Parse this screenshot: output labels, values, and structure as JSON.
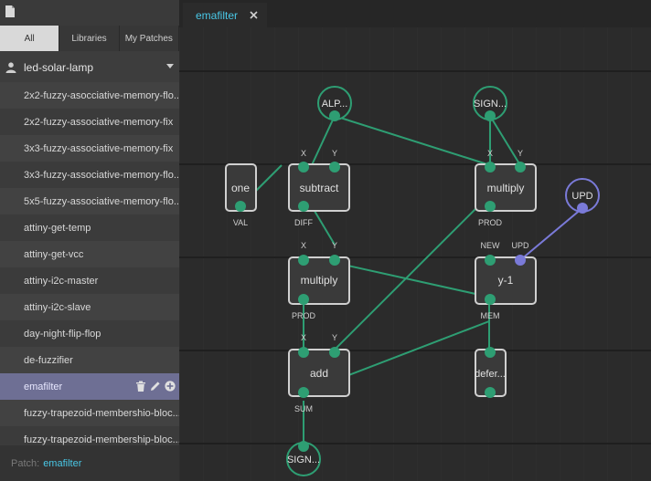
{
  "sidebar": {
    "tabs": [
      {
        "label": "All",
        "active": true
      },
      {
        "label": "Libraries",
        "active": false
      },
      {
        "label": "My Patches",
        "active": false
      }
    ],
    "project": "led-solar-lamp",
    "patches": [
      "2x2-fuzzy-asocciative-memory-flo...",
      "2x2-fuzzy-associative-memory-fix",
      "3x3-fuzzy-associative-memory-fix",
      "3x3-fuzzy-associative-memory-flo...",
      "5x5-fuzzy-associative-memory-flo...",
      "attiny-get-temp",
      "attiny-get-vcc",
      "attiny-i2c-master",
      "attiny-i2c-slave",
      "day-night-flip-flop",
      "de-fuzzifier",
      "emafilter",
      "fuzzy-trapezoid-membershio-bloc...",
      "fuzzy-trapezoid-membership-bloc..."
    ],
    "selected_patch": "emafilter",
    "footer_label": "Patch:",
    "footer_value": "emafilter"
  },
  "editor": {
    "tab_label": "emafilter"
  },
  "graph": {
    "nodes": {
      "alpha": {
        "label": "ALP..."
      },
      "signal_in": {
        "label": "SIGN..."
      },
      "one": {
        "label": "one",
        "out": "VAL"
      },
      "subtract": {
        "label": "subtract",
        "in1": "X",
        "in2": "Y",
        "out": "DIFF"
      },
      "multiply1": {
        "label": "multiply",
        "in1": "X",
        "in2": "Y",
        "out": "PROD"
      },
      "upd": {
        "label": "UPD"
      },
      "multiply2": {
        "label": "multiply",
        "in1": "X",
        "in2": "Y",
        "out": "PROD"
      },
      "buffer": {
        "label": "y-1",
        "in1": "NEW",
        "in2": "UPD",
        "out": "MEM"
      },
      "add": {
        "label": "add",
        "in1": "X",
        "in2": "Y",
        "out": "SUM"
      },
      "defer": {
        "label": "defer..."
      },
      "signal_out": {
        "label": "SIGN..."
      }
    }
  },
  "colors": {
    "accent": "#49c7e6",
    "pin": "#2e9e73",
    "link": "#2e9e73",
    "pulse": "#7a7ad8",
    "selected": "#6e6f94"
  },
  "icons": [
    "file-icon",
    "user-icon",
    "chevron-down-icon",
    "trash-icon",
    "pencil-icon",
    "add-icon",
    "close-icon"
  ]
}
